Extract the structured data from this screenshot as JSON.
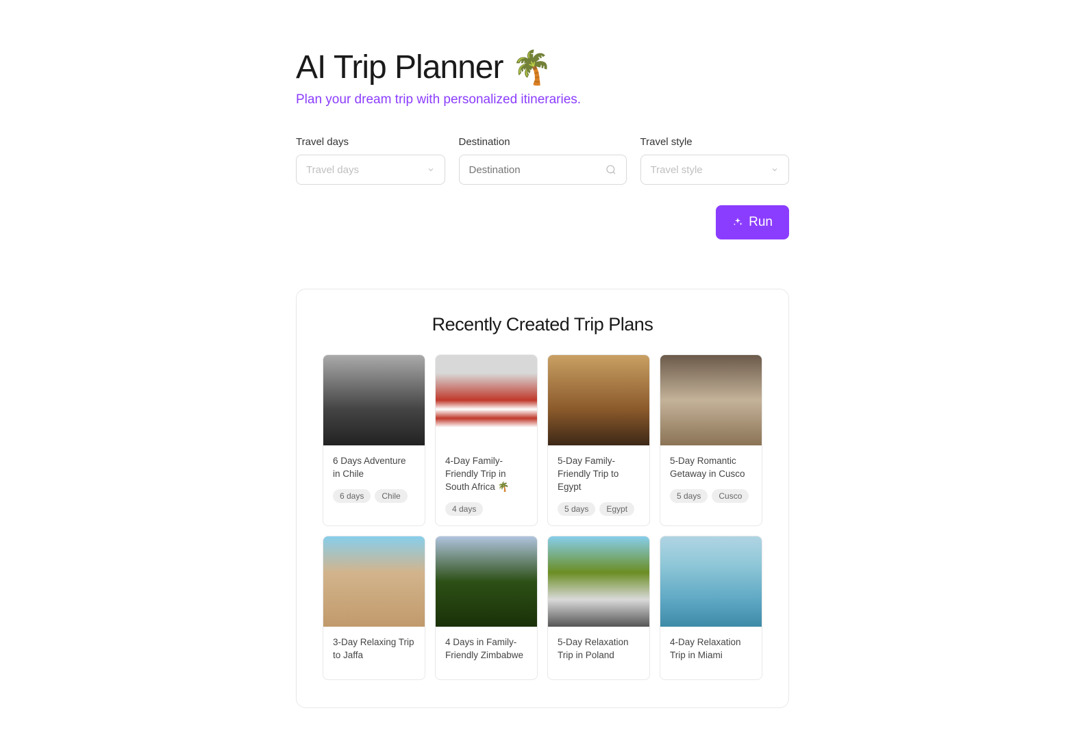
{
  "header": {
    "title": "AI Trip Planner",
    "emoji": "🌴",
    "subtitle": "Plan your dream trip with personalized itineraries."
  },
  "form": {
    "travel_days": {
      "label": "Travel days",
      "placeholder": "Travel days"
    },
    "destination": {
      "label": "Destination",
      "placeholder": "Destination"
    },
    "travel_style": {
      "label": "Travel style",
      "placeholder": "Travel style"
    },
    "run_label": "Run"
  },
  "recent": {
    "title": "Recently Created Trip Plans",
    "cards": [
      {
        "title": "6 Days Adventure in Chile",
        "tag1": "6 days",
        "tag2": "Chile",
        "img": "img-chile"
      },
      {
        "title": "4-Day Family-Friendly Trip in South Africa 🌴",
        "tag1": "4 days",
        "tag2": "",
        "img": "img-sa"
      },
      {
        "title": "5-Day Family-Friendly Trip to Egypt",
        "tag1": "5 days",
        "tag2": "Egypt",
        "img": "img-egypt"
      },
      {
        "title": "5-Day Romantic Getaway in Cusco",
        "tag1": "5 days",
        "tag2": "Cusco",
        "img": "img-cusco"
      },
      {
        "title": "3-Day Relaxing Trip to Jaffa",
        "tag1": "",
        "tag2": "",
        "img": "img-jaffa"
      },
      {
        "title": "4 Days in Family-Friendly Zimbabwe",
        "tag1": "",
        "tag2": "",
        "img": "img-zimbabwe"
      },
      {
        "title": "5-Day Relaxation Trip in Poland",
        "tag1": "",
        "tag2": "",
        "img": "img-poland"
      },
      {
        "title": "4-Day Relaxation Trip in Miami",
        "tag1": "",
        "tag2": "",
        "img": "img-miami"
      }
    ]
  }
}
